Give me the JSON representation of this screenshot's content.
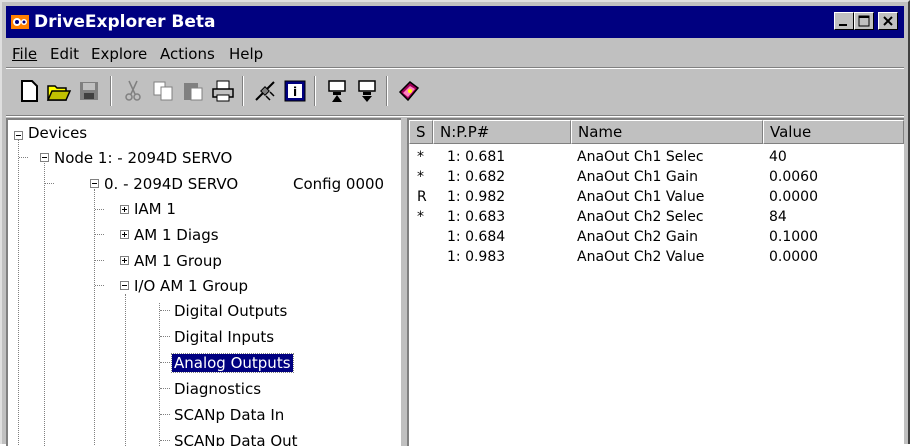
{
  "window": {
    "title": "DriveExplorer Beta"
  },
  "menu": [
    {
      "label": "File"
    },
    {
      "label": "Edit"
    },
    {
      "label": "Explore"
    },
    {
      "label": "Actions"
    },
    {
      "label": "Help"
    }
  ],
  "tree": {
    "root": "Devices",
    "node": "Node 1: - 2094D SERVO",
    "device": "0. - 2094D SERVO",
    "config": "Config 0000",
    "groups": [
      "IAM 1",
      "AM 1 Diags",
      "AM 1 Group",
      "I/O AM 1 Group"
    ],
    "children": [
      "Digital Outputs",
      "Digital Inputs",
      "Analog Outputs",
      "Diagnostics",
      "SCANp Data In",
      "SCANp Data Out"
    ]
  },
  "table": {
    "columns": [
      "S",
      "N:P.P#",
      "Name",
      "Value"
    ],
    "rows": [
      {
        "s": "*",
        "npp": "1: 0.681",
        "name": "AnaOut Ch1 Selec",
        "value": "40"
      },
      {
        "s": "*",
        "npp": "1: 0.682",
        "name": "AnaOut Ch1 Gain",
        "value": "0.0060"
      },
      {
        "s": "R",
        "npp": "1: 0.982",
        "name": "AnaOut Ch1 Value",
        "value": "0.0000"
      },
      {
        "s": "*",
        "npp": "1: 0.683",
        "name": "AnaOut Ch2 Selec",
        "value": "84"
      },
      {
        "s": "",
        "npp": "1: 0.684",
        "name": "AnaOut Ch2 Gain",
        "value": "0.1000"
      },
      {
        "s": "",
        "npp": "1: 0.983",
        "name": "AnaOut Ch2 Value",
        "value": "0.0000"
      }
    ]
  },
  "toolbar_icons": [
    "new-icon",
    "open-icon",
    "save-icon",
    "cut-icon",
    "copy-icon",
    "paste-icon",
    "print-icon",
    "connect-icon",
    "properties-icon",
    "upload-icon",
    "download-icon",
    "help-book-icon"
  ],
  "colors": {
    "titlebar": "#000080",
    "selection": "#000080",
    "face": "#c0c0c0"
  }
}
